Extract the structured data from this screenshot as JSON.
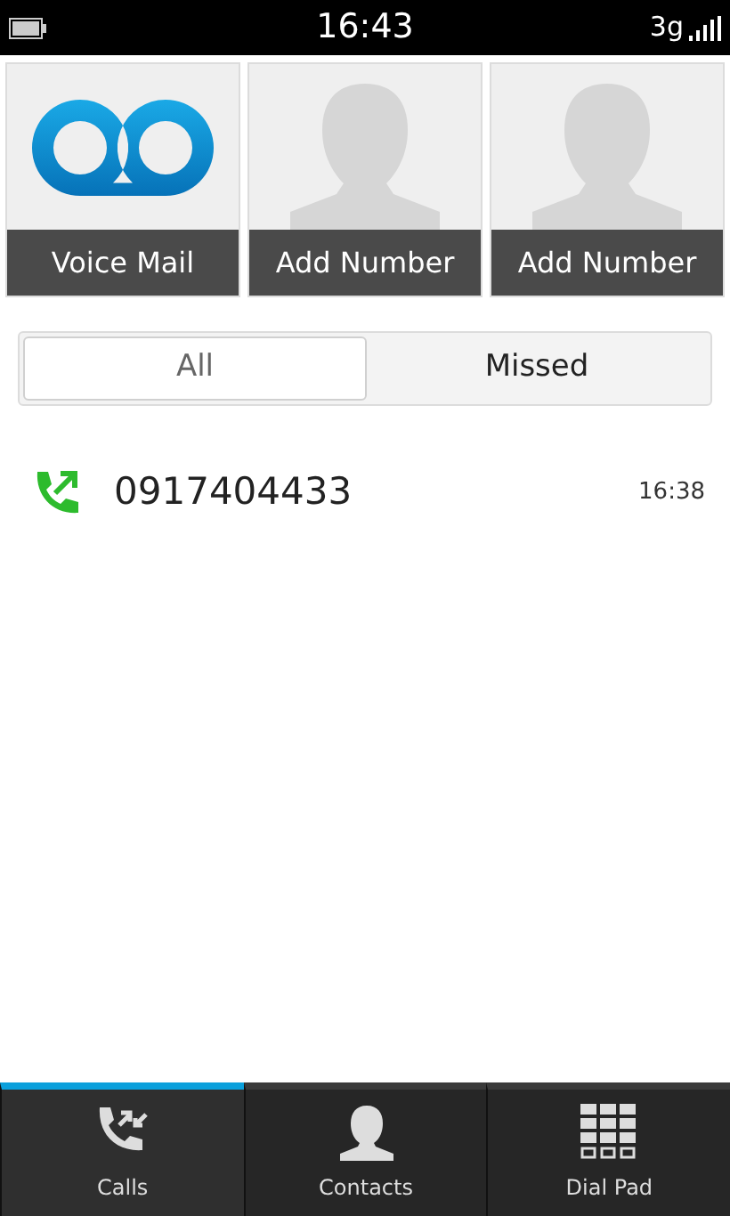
{
  "status_bar": {
    "time": "16:43",
    "network": "3g"
  },
  "speed_dial": [
    {
      "kind": "voicemail",
      "label": "Voice Mail"
    },
    {
      "kind": "contact",
      "label": "Add Number"
    },
    {
      "kind": "contact",
      "label": "Add Number"
    }
  ],
  "filter_tabs": [
    {
      "label": "All",
      "selected": true
    },
    {
      "label": "Missed",
      "selected": false
    }
  ],
  "calls": [
    {
      "kind": "outgoing",
      "number": "0917404433",
      "time": "16:38"
    }
  ],
  "tabs": [
    {
      "kind": "calls",
      "label": "Calls",
      "selected": true
    },
    {
      "kind": "contacts",
      "label": "Contacts",
      "selected": false
    },
    {
      "kind": "dialpad",
      "label": "Dial Pad",
      "selected": false
    }
  ]
}
